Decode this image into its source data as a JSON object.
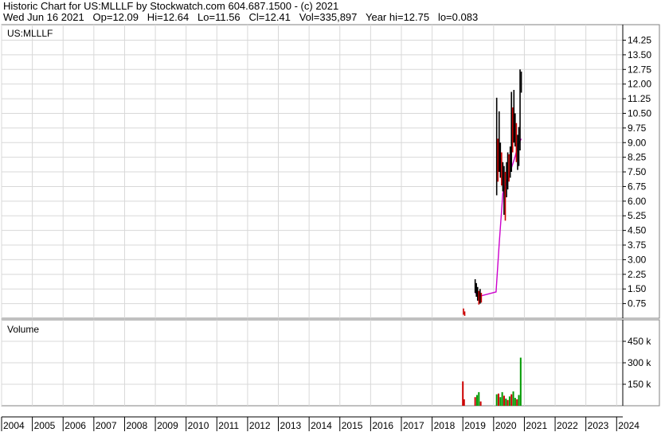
{
  "header": {
    "line1": "Historic Chart for US:MLLLF by Stockwatch.com 604.687.1500 - (c) 2021",
    "line2": "Wed Jun 16 2021   Op=12.09   Hi=12.64   Lo=11.56   Cl=12.41   Vol=335,897   Year hi=12.75   lo=0.083"
  },
  "chart_data": [
    {
      "type": "line",
      "title": "US:MLLLF",
      "yticks": [
        "14.25",
        "13.50",
        "12.75",
        "12.00",
        "11.25",
        "10.50",
        "9.75",
        "9.00",
        "8.25",
        "7.50",
        "6.75",
        "6.00",
        "5.25",
        "4.50",
        "3.75",
        "3.00",
        "2.25",
        "1.50",
        "0.75"
      ],
      "ylim": [
        0,
        14.8
      ],
      "xlim": [
        2004,
        2024.2
      ],
      "xticks": [
        "2004",
        "2005",
        "2006",
        "2007",
        "2008",
        "2009",
        "2010",
        "2011",
        "2012",
        "2013",
        "2014",
        "2015",
        "2016",
        "2017",
        "2018",
        "2019",
        "2020",
        "2021",
        "2022",
        "2023",
        "2024"
      ],
      "grid": true,
      "price_bars": [
        {
          "x": 2019.02,
          "lo": 0.18,
          "hi": 0.5,
          "color": "#cc0000"
        },
        {
          "x": 2019.06,
          "lo": 0.12,
          "hi": 0.35,
          "color": "#cc0000"
        },
        {
          "x": 2019.4,
          "lo": 1.3,
          "hi": 2.0,
          "color": "#000000"
        },
        {
          "x": 2019.44,
          "lo": 1.1,
          "hi": 1.8,
          "color": "#000000"
        },
        {
          "x": 2019.48,
          "lo": 0.9,
          "hi": 1.6,
          "color": "#000000"
        },
        {
          "x": 2019.52,
          "lo": 0.7,
          "hi": 1.4,
          "color": "#cc0000"
        },
        {
          "x": 2019.56,
          "lo": 0.75,
          "hi": 1.5,
          "color": "#000000"
        },
        {
          "x": 2019.6,
          "lo": 0.8,
          "hi": 1.3,
          "color": "#cc0000"
        },
        {
          "x": 2020.1,
          "lo": 6.3,
          "hi": 11.3,
          "color": "#000000"
        },
        {
          "x": 2020.14,
          "lo": 7.0,
          "hi": 9.2,
          "color": "#cc0000"
        },
        {
          "x": 2020.18,
          "lo": 7.5,
          "hi": 10.6,
          "color": "#000000"
        },
        {
          "x": 2020.22,
          "lo": 7.2,
          "hi": 9.0,
          "color": "#000000"
        },
        {
          "x": 2020.26,
          "lo": 6.8,
          "hi": 8.5,
          "color": "#cc0000"
        },
        {
          "x": 2020.3,
          "lo": 6.5,
          "hi": 8.0,
          "color": "#000000"
        },
        {
          "x": 2020.34,
          "lo": 5.3,
          "hi": 7.8,
          "color": "#000000"
        },
        {
          "x": 2020.38,
          "lo": 5.0,
          "hi": 7.5,
          "color": "#cc0000"
        },
        {
          "x": 2020.42,
          "lo": 6.2,
          "hi": 8.0,
          "color": "#000000"
        },
        {
          "x": 2020.46,
          "lo": 6.6,
          "hi": 8.5,
          "color": "#000000"
        },
        {
          "x": 2020.5,
          "lo": 7.0,
          "hi": 8.4,
          "color": "#cc0000"
        },
        {
          "x": 2020.54,
          "lo": 7.2,
          "hi": 8.8,
          "color": "#000000"
        },
        {
          "x": 2020.58,
          "lo": 7.5,
          "hi": 11.6,
          "color": "#000000"
        },
        {
          "x": 2020.62,
          "lo": 8.5,
          "hi": 10.8,
          "color": "#cc0000"
        },
        {
          "x": 2020.66,
          "lo": 9.0,
          "hi": 11.7,
          "color": "#000000"
        },
        {
          "x": 2020.7,
          "lo": 8.8,
          "hi": 10.5,
          "color": "#000000"
        },
        {
          "x": 2020.74,
          "lo": 8.0,
          "hi": 10.0,
          "color": "#cc0000"
        },
        {
          "x": 2020.78,
          "lo": 7.6,
          "hi": 9.4,
          "color": "#000000"
        },
        {
          "x": 2020.82,
          "lo": 7.8,
          "hi": 9.8,
          "color": "#000000"
        },
        {
          "x": 2020.86,
          "lo": 8.6,
          "hi": 12.75,
          "color": "#000000"
        },
        {
          "x": 2020.9,
          "lo": 11.56,
          "hi": 12.64,
          "color": "#000000"
        }
      ],
      "moving_average": {
        "color": "#cc00cc",
        "x": [
          2019.4,
          2019.5,
          2019.6,
          2020.08,
          2020.18,
          2020.3,
          2020.4,
          2020.5,
          2020.6,
          2020.7,
          2020.8,
          2020.9
        ],
        "y": [
          1.3,
          1.2,
          1.15,
          1.35,
          3.8,
          6.4,
          6.9,
          7.3,
          7.8,
          8.3,
          8.9,
          9.2
        ]
      }
    },
    {
      "type": "bar",
      "title": "Volume",
      "yticks": [
        "450 k",
        "300 k",
        "150 k"
      ],
      "ylim": [
        0,
        600000
      ],
      "xlim": [
        2004,
        2024.2
      ],
      "grid": true,
      "bars": [
        {
          "x": 2019.0,
          "v": 170000,
          "color": "#cc0000"
        },
        {
          "x": 2019.04,
          "v": 45000,
          "color": "#cc0000"
        },
        {
          "x": 2019.4,
          "v": 60000,
          "color": "#cc0000"
        },
        {
          "x": 2019.46,
          "v": 75000,
          "color": "#009900"
        },
        {
          "x": 2019.52,
          "v": 95000,
          "color": "#009900"
        },
        {
          "x": 2019.58,
          "v": 30000,
          "color": "#cc0000"
        },
        {
          "x": 2020.1,
          "v": 80000,
          "color": "#009900"
        },
        {
          "x": 2020.16,
          "v": 85000,
          "color": "#cc0000"
        },
        {
          "x": 2020.22,
          "v": 60000,
          "color": "#009900"
        },
        {
          "x": 2020.28,
          "v": 95000,
          "color": "#009900"
        },
        {
          "x": 2020.34,
          "v": 70000,
          "color": "#cc0000"
        },
        {
          "x": 2020.4,
          "v": 50000,
          "color": "#009900"
        },
        {
          "x": 2020.46,
          "v": 40000,
          "color": "#cc0000"
        },
        {
          "x": 2020.52,
          "v": 65000,
          "color": "#009900"
        },
        {
          "x": 2020.58,
          "v": 80000,
          "color": "#cc0000"
        },
        {
          "x": 2020.64,
          "v": 100000,
          "color": "#009900"
        },
        {
          "x": 2020.7,
          "v": 55000,
          "color": "#009900"
        },
        {
          "x": 2020.76,
          "v": 45000,
          "color": "#cc0000"
        },
        {
          "x": 2020.82,
          "v": 75000,
          "color": "#009900"
        },
        {
          "x": 2020.88,
          "v": 335897,
          "color": "#009900"
        }
      ]
    }
  ]
}
